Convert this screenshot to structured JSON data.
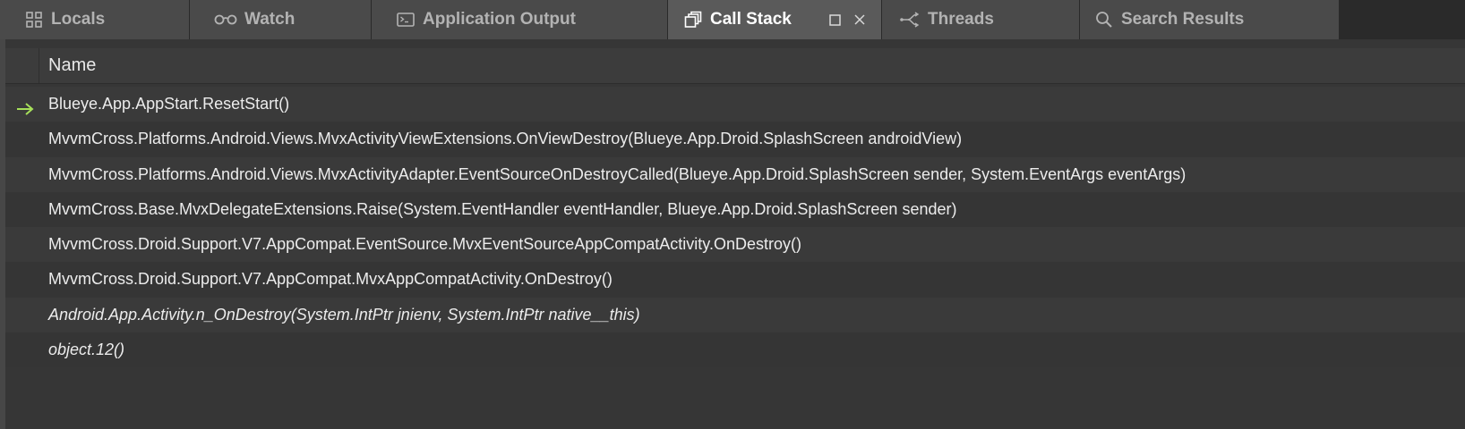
{
  "tabs": [
    {
      "id": "locals",
      "label": "Locals",
      "icon": "grid-icon",
      "active": false
    },
    {
      "id": "watch",
      "label": "Watch",
      "icon": "glasses-icon",
      "active": false
    },
    {
      "id": "output",
      "label": "Application Output",
      "icon": "terminal-icon",
      "active": false
    },
    {
      "id": "callstack",
      "label": "Call Stack",
      "icon": "stack-icon",
      "active": true
    },
    {
      "id": "threads",
      "label": "Threads",
      "icon": "threads-icon",
      "active": false
    },
    {
      "id": "search",
      "label": "Search Results",
      "icon": "search-icon",
      "active": false
    }
  ],
  "tab_actions": {
    "maximize_icon": "square-icon",
    "close_icon": "close-icon"
  },
  "columns": {
    "name": "Name"
  },
  "current_frame_icon": "arrow-right-icon",
  "frames": [
    {
      "text": "Blueye.App.AppStart.ResetStart()",
      "current": true,
      "italic": false
    },
    {
      "text": "MvvmCross.Platforms.Android.Views.MvxActivityViewExtensions.OnViewDestroy(Blueye.App.Droid.SplashScreen androidView)",
      "current": false,
      "italic": false
    },
    {
      "text": "MvvmCross.Platforms.Android.Views.MvxActivityAdapter.EventSourceOnDestroyCalled(Blueye.App.Droid.SplashScreen sender, System.EventArgs eventArgs)",
      "current": false,
      "italic": false
    },
    {
      "text": "MvvmCross.Base.MvxDelegateExtensions.Raise(System.EventHandler eventHandler, Blueye.App.Droid.SplashScreen sender)",
      "current": false,
      "italic": false
    },
    {
      "text": "MvvmCross.Droid.Support.V7.AppCompat.EventSource.MvxEventSourceAppCompatActivity.OnDestroy()",
      "current": false,
      "italic": false
    },
    {
      "text": "MvvmCross.Droid.Support.V7.AppCompat.MvxAppCompatActivity.OnDestroy()",
      "current": false,
      "italic": false
    },
    {
      "text": "Android.App.Activity.n_OnDestroy(System.IntPtr jnienv, System.IntPtr native__this)",
      "current": false,
      "italic": true
    },
    {
      "text": "object.12()",
      "current": false,
      "italic": true
    }
  ],
  "colors": {
    "current_arrow": "#a6e05a",
    "active_tab_text": "#ffffff",
    "inactive_tab_text": "#b3b3b3"
  }
}
